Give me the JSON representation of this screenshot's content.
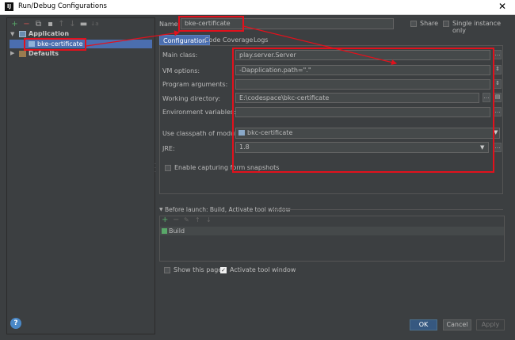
{
  "window": {
    "title": "Run/Debug Configurations",
    "app_icon_text": "IJ",
    "close_glyph": "✕"
  },
  "toolbar": {
    "add": "+",
    "remove": "−",
    "copy": "⧉",
    "save": "▪",
    "up": "↑",
    "down": "↓",
    "folder": "▬",
    "sort": "↓a"
  },
  "tree": {
    "app_label": "Application",
    "child_label": "bke-certificate",
    "defaults_label": "Defaults"
  },
  "header": {
    "name_label": "Name:",
    "name_value": "bke-certificate",
    "share_label": "Share",
    "single_instance_label": "Single instance only"
  },
  "tabs": [
    {
      "label": "Configuration"
    },
    {
      "label": "Code Coverage"
    },
    {
      "label": "Logs"
    }
  ],
  "form": {
    "main_class_label": "Main class:",
    "main_class_value": "play.server.Server",
    "vm_options_label": "VM options:",
    "vm_options_value": "-Dapplication.path=\".\"",
    "program_args_label": "Program arguments:",
    "program_args_value": "",
    "working_dir_label": "Working directory:",
    "working_dir_value": "E:\\codespace\\bkc-certificate",
    "env_vars_label": "Environment variables:",
    "env_vars_value": "",
    "classpath_label": "Use classpath of module:",
    "classpath_value": "bkc-certificate",
    "jre_label": "JRE:",
    "jre_value": "1.8",
    "capture_label": "Enable capturing form snapshots"
  },
  "before_launch": {
    "title": "Before launch: Build, Activate tool window",
    "build_item": "Build"
  },
  "bottom": {
    "show_page_label": "Show this page",
    "activate_label": "Activate tool window",
    "ok": "OK",
    "cancel": "Cancel",
    "apply": "Apply",
    "help": "?"
  },
  "colors": {
    "background": "#3c3f41",
    "selection": "#4b6eaf",
    "annotation_red": "#e2111c",
    "ok_button": "#365880"
  }
}
